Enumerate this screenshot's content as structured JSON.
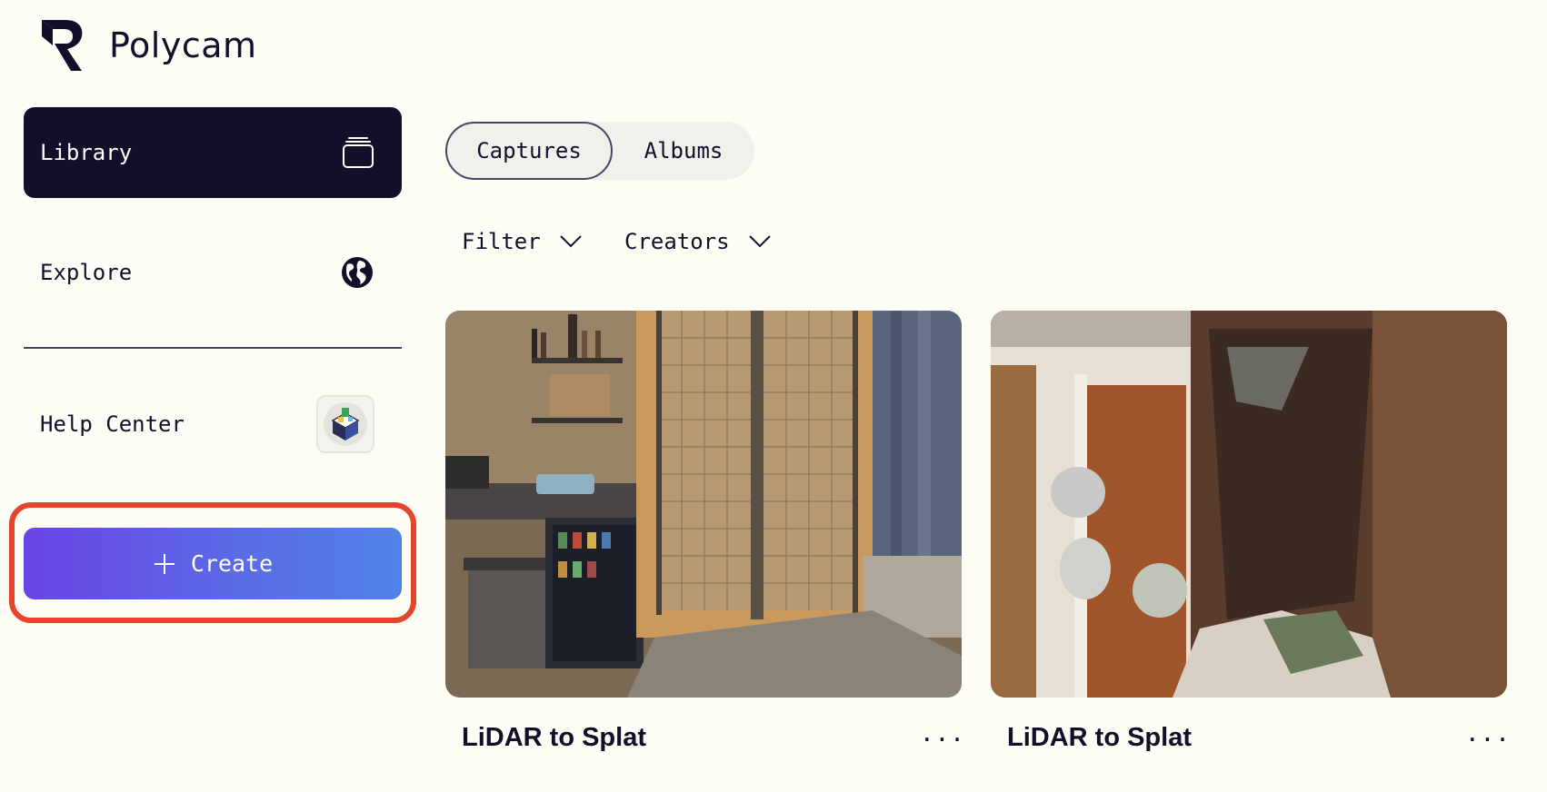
{
  "app": {
    "name": "Polycam"
  },
  "sidebar": {
    "items": [
      {
        "label": "Library",
        "icon": "library-stack-icon",
        "active": true
      },
      {
        "label": "Explore",
        "icon": "globe-icon",
        "active": false
      },
      {
        "label": "Help Center",
        "icon": "help-avatar-icon",
        "active": false
      }
    ],
    "create_label": "Create"
  },
  "tabs": [
    {
      "label": "Captures",
      "selected": true
    },
    {
      "label": "Albums",
      "selected": false
    }
  ],
  "filters": [
    {
      "label": "Filter"
    },
    {
      "label": "Creators"
    }
  ],
  "captures": [
    {
      "title": "LiDAR to Splat",
      "more": "···"
    },
    {
      "title": "LiDAR to Splat",
      "more": "···"
    }
  ],
  "colors": {
    "background": "#fdfcf5",
    "ink": "#120f2b",
    "create_gradient_start": "#6a44e6",
    "create_gradient_end": "#5083e8",
    "highlight": "#e5452c"
  }
}
